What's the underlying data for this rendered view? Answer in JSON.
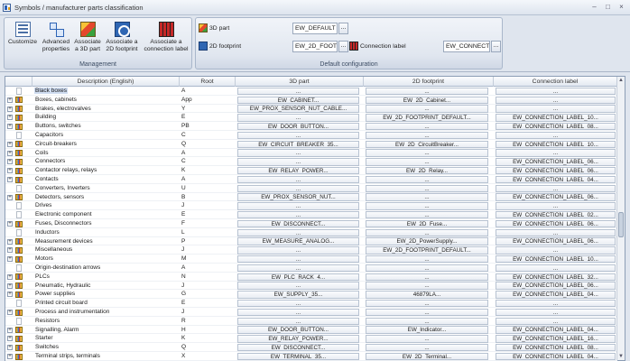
{
  "window": {
    "title": "Symbols / manufacturer parts classification",
    "controls": {
      "minimize": "–",
      "maximize": "□",
      "close": "×"
    }
  },
  "ribbon": {
    "management": {
      "caption": "Management",
      "buttons": [
        {
          "label_1": "Customize",
          "label_2": "",
          "icon": "customize-icon"
        },
        {
          "label_1": "Advanced",
          "label_2": "properties",
          "icon": "advanced-properties-icon"
        },
        {
          "label_1": "Associate",
          "label_2": "a 3D part",
          "icon": "cube-3d-icon"
        },
        {
          "label_1": "Associate a",
          "label_2": "2D footprint",
          "icon": "footprint-2d-icon"
        },
        {
          "label_1": "Associate a",
          "label_2": "connection label",
          "icon": "connection-label-icon"
        }
      ]
    },
    "default_configuration": {
      "caption": "Default configuration",
      "part_3d_label": "3D part",
      "part_3d_value": "EW_DEFAULT",
      "footprint_2d_label": "2D footprint",
      "footprint_2d_value": "EW_2D_FOOTI",
      "connection_label_label": "Connection label",
      "connection_label_value": "EW_CONNECT",
      "browse": "..."
    }
  },
  "grid": {
    "columns": [
      "Description (English)",
      "Root",
      "3D part",
      "2D footprint",
      "Connection label"
    ],
    "rows": [
      {
        "expand": "",
        "icon": "blank",
        "desc": "Black boxes",
        "root": "A",
        "p3d": "...",
        "p2d": "...",
        "conn": "...",
        "selected": true
      },
      {
        "expand": "+",
        "icon": "bar",
        "desc": "Boxes, cabinets",
        "root": "App",
        "p3d": "EW_CABINET...",
        "p2d": "EW_2D_Cabinet...",
        "conn": "..."
      },
      {
        "expand": "+",
        "icon": "bar",
        "desc": "Brakes, electrovalves",
        "root": "Y",
        "p3d": "EW_PROX_SENSOR_NUT_CABLE...",
        "p2d": "...",
        "conn": "..."
      },
      {
        "expand": "+",
        "icon": "bar",
        "desc": "Building",
        "root": "E",
        "p3d": "...",
        "p2d": "EW_2D_FOOTPRINT_DEFAULT...",
        "conn": "EW_CONNECTION_LABEL_10..."
      },
      {
        "expand": "+",
        "icon": "bar",
        "desc": "Buttons, switches",
        "root": "PB",
        "p3d": "EW_DOOR_BUTTON...",
        "p2d": "...",
        "conn": "EW_CONNECTION_LABEL_08..."
      },
      {
        "expand": "",
        "icon": "blank",
        "desc": "Capacitors",
        "root": "C",
        "p3d": "...",
        "p2d": "...",
        "conn": "..."
      },
      {
        "expand": "+",
        "icon": "bar",
        "desc": "Circuit-breakers",
        "root": "Q",
        "p3d": "EW_CIRCUIT_BREAKER_35...",
        "p2d": "EW_2D_CircuitBreaker...",
        "conn": "EW_CONNECTION_LABEL_10..."
      },
      {
        "expand": "+",
        "icon": "bar",
        "desc": "Coils",
        "root": "A",
        "p3d": "...",
        "p2d": "...",
        "conn": "..."
      },
      {
        "expand": "+",
        "icon": "bar",
        "desc": "Connectors",
        "root": "C",
        "p3d": "...",
        "p2d": "...",
        "conn": "EW_CONNECTION_LABEL_06..."
      },
      {
        "expand": "+",
        "icon": "bar",
        "desc": "Contactor relays, relays",
        "root": "K",
        "p3d": "EW_RELAY_POWER...",
        "p2d": "EW_2D_Relay...",
        "conn": "EW_CONNECTION_LABEL_06..."
      },
      {
        "expand": "+",
        "icon": "bar",
        "desc": "Contacts",
        "root": "A",
        "p3d": "...",
        "p2d": "...",
        "conn": "EW_CONNECTION_LABEL_04..."
      },
      {
        "expand": "",
        "icon": "blank",
        "desc": "Converters, Inverters",
        "root": "U",
        "p3d": "...",
        "p2d": "...",
        "conn": "..."
      },
      {
        "expand": "+",
        "icon": "bar",
        "desc": "Detectors, sensors",
        "root": "B",
        "p3d": "EW_PROX_SENSOR_NUT...",
        "p2d": "...",
        "conn": "EW_CONNECTION_LABEL_06..."
      },
      {
        "expand": "",
        "icon": "blank",
        "desc": "Drives",
        "root": "J",
        "p3d": "...",
        "p2d": "...",
        "conn": "..."
      },
      {
        "expand": "",
        "icon": "blank",
        "desc": "Electronic component",
        "root": "E",
        "p3d": "...",
        "p2d": "...",
        "conn": "EW_CONNECTION_LABEL_02..."
      },
      {
        "expand": "+",
        "icon": "bar",
        "desc": "Fuses, Disconnectors",
        "root": "F",
        "p3d": "EW_DISCONNECT...",
        "p2d": "EW_2D_Fuse...",
        "conn": "EW_CONNECTION_LABEL_06..."
      },
      {
        "expand": "",
        "icon": "blank",
        "desc": "Inductors",
        "root": "L",
        "p3d": "...",
        "p2d": "...",
        "conn": "..."
      },
      {
        "expand": "+",
        "icon": "bar",
        "desc": "Measurement devices",
        "root": "P",
        "p3d": "EW_MEASURE_ANALOG...",
        "p2d": "EW_2D_PowerSupply...",
        "conn": "EW_CONNECTION_LABEL_06..."
      },
      {
        "expand": "+",
        "icon": "bar",
        "desc": "Miscellaneous",
        "root": "J",
        "p3d": "...",
        "p2d": "EW_2D_FOOTPRINT_DEFAULT...",
        "conn": "..."
      },
      {
        "expand": "+",
        "icon": "bar",
        "desc": "Motors",
        "root": "M",
        "p3d": "...",
        "p2d": "...",
        "conn": "EW_CONNECTION_LABEL_10..."
      },
      {
        "expand": "",
        "icon": "blank",
        "desc": "Origin-destination arrows",
        "root": "A",
        "p3d": "...",
        "p2d": "...",
        "conn": "..."
      },
      {
        "expand": "+",
        "icon": "bar",
        "desc": "PLCs",
        "root": "N",
        "p3d": "EW_PLC_RACK_4...",
        "p2d": "...",
        "conn": "EW_CONNECTION_LABEL_32..."
      },
      {
        "expand": "+",
        "icon": "bar",
        "desc": "Pneumatic, Hydraulic",
        "root": "J",
        "p3d": "...",
        "p2d": "...",
        "conn": "EW_CONNECTION_LABEL_06..."
      },
      {
        "expand": "+",
        "icon": "bar",
        "desc": "Power supplies",
        "root": "G",
        "p3d": "EW_SUPPLY_35...",
        "p2d": "46879LA...",
        "conn": "EW_CONNECTION_LABEL_04..."
      },
      {
        "expand": "",
        "icon": "blank",
        "desc": "Printed circuit board",
        "root": "E",
        "p3d": "...",
        "p2d": "...",
        "conn": "..."
      },
      {
        "expand": "+",
        "icon": "bar",
        "desc": "Process and instrumentation",
        "root": "J",
        "p3d": "...",
        "p2d": "...",
        "conn": "..."
      },
      {
        "expand": "",
        "icon": "blank",
        "desc": "Resistors",
        "root": "R",
        "p3d": "...",
        "p2d": "...",
        "conn": "..."
      },
      {
        "expand": "+",
        "icon": "bar",
        "desc": "Signalling, Alarm",
        "root": "H",
        "p3d": "EW_DOOR_BUTTON...",
        "p2d": "EW_Indicator...",
        "conn": "EW_CONNECTION_LABEL_04..."
      },
      {
        "expand": "+",
        "icon": "bar",
        "desc": "Starter",
        "root": "K",
        "p3d": "EW_RELAY_POWER...",
        "p2d": "...",
        "conn": "EW_CONNECTION_LABEL_16..."
      },
      {
        "expand": "+",
        "icon": "bar",
        "desc": "Switches",
        "root": "Q",
        "p3d": "EW_DISCONNECT...",
        "p2d": "...",
        "conn": "EW_CONNECTION_LABEL_08..."
      },
      {
        "expand": "+",
        "icon": "bar",
        "desc": "Terminal strips, terminals",
        "root": "X",
        "p3d": "EW_TERMINAL_35...",
        "p2d": "EW_2D_Terminal...",
        "conn": "EW_CONNECTION_LABEL_04..."
      }
    ]
  }
}
